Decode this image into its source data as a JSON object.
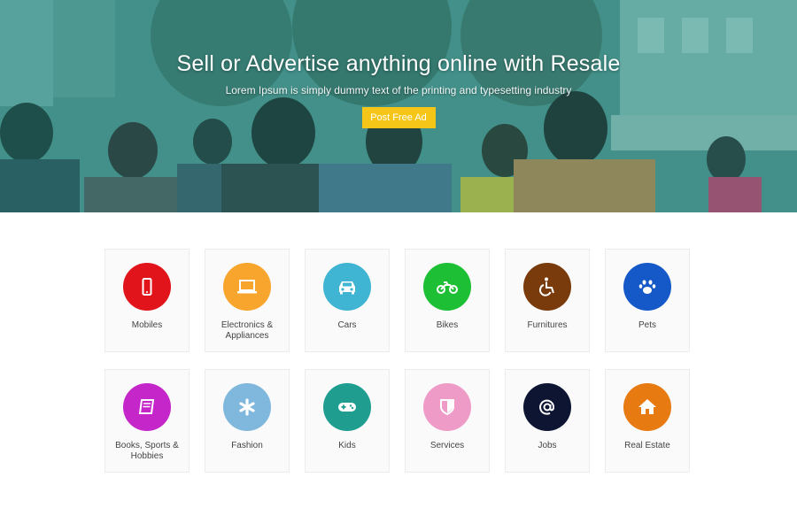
{
  "hero": {
    "title": "Sell or Advertise anything online with Resale",
    "subtitle": "Lorem Ipsum is simply dummy text of the printing and typesetting industry",
    "button_label": "Post Free Ad",
    "button_color": "#f5c518"
  },
  "categories": [
    {
      "label": "Mobiles",
      "icon": "mobile-icon",
      "color": "#e0141a"
    },
    {
      "label": "Electronics &\nAppliances",
      "icon": "laptop-icon",
      "color": "#f7a52c"
    },
    {
      "label": "Cars",
      "icon": "car-icon",
      "color": "#3fb5d3"
    },
    {
      "label": "Bikes",
      "icon": "motorbike-icon",
      "color": "#1dbf35"
    },
    {
      "label": "Furnitures",
      "icon": "wheelchair-icon",
      "color": "#7a3b0c"
    },
    {
      "label": "Pets",
      "icon": "paw-icon",
      "color": "#1559c8"
    },
    {
      "label": "Books, Sports &\nHobbies",
      "icon": "book-icon",
      "color": "#c526c9"
    },
    {
      "label": "Fashion",
      "icon": "asterisk-icon",
      "color": "#7fb7dd"
    },
    {
      "label": "Kids",
      "icon": "gamepad-icon",
      "color": "#1f9e90"
    },
    {
      "label": "Services",
      "icon": "shield-icon",
      "color": "#ef9bc8"
    },
    {
      "label": "Jobs",
      "icon": "at-sign-icon",
      "color": "#0d1532"
    },
    {
      "label": "Real Estate",
      "icon": "home-icon",
      "color": "#e87a12"
    }
  ]
}
